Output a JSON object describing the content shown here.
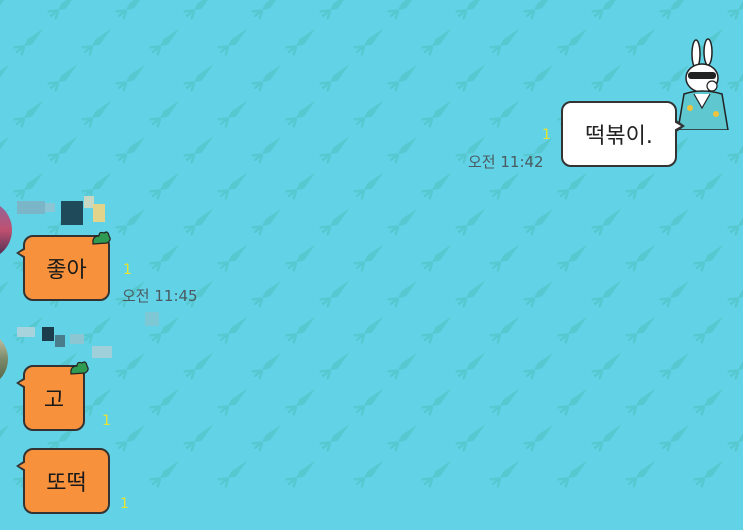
{
  "theme": {
    "background": "#62d3e6",
    "wallpaper_icon": "carrot-icon",
    "wallpaper_icon_color": "#4fbfbf",
    "bubble_in_color": "#f7913c",
    "bubble_out_color": "#ffffff",
    "unread_color": "#e8e230"
  },
  "messages": [
    {
      "side": "out",
      "text": "떡볶이.",
      "time": "오전 11:42",
      "unread": "1"
    },
    {
      "side": "in",
      "text": "좋아",
      "time": "오전 11:45",
      "unread": "1"
    },
    {
      "side": "in",
      "text": "고",
      "unread": "1"
    },
    {
      "side": "in",
      "text": "또떡",
      "unread": "1"
    }
  ]
}
